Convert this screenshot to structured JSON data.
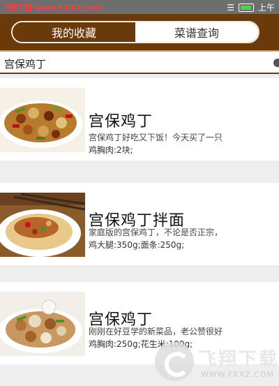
{
  "status_bar": {
    "watermark": "飞翔下载 www.FXXZ.com",
    "right_text": "上午"
  },
  "tabs": [
    {
      "label": "我的收藏",
      "active": false
    },
    {
      "label": "菜谱查询",
      "active": true
    }
  ],
  "search": {
    "value": "宫保鸡丁"
  },
  "recipes": [
    {
      "title": "宫保鸡丁",
      "desc": "宫保鸡丁好吃又下饭！今天买了一只",
      "ingredients": "鸡胸肉:2块;"
    },
    {
      "title": "宫保鸡丁拌面",
      "desc": "家庭版的宫保鸡丁，不论是否正宗，",
      "ingredients": "鸡大腿:350g;面条:250g;"
    },
    {
      "title": "宫保鸡丁",
      "desc": "刚刚在好豆学的新菜品，老公赞很好",
      "ingredients": "鸡胸肉:250g;花生米:100g;"
    }
  ],
  "watermark_logo": {
    "text": "飞翔下载",
    "sub": "WWW.FXXZ.COM"
  },
  "colors": {
    "header": "#6b3a0a",
    "accent_line": "#c9a36a"
  }
}
